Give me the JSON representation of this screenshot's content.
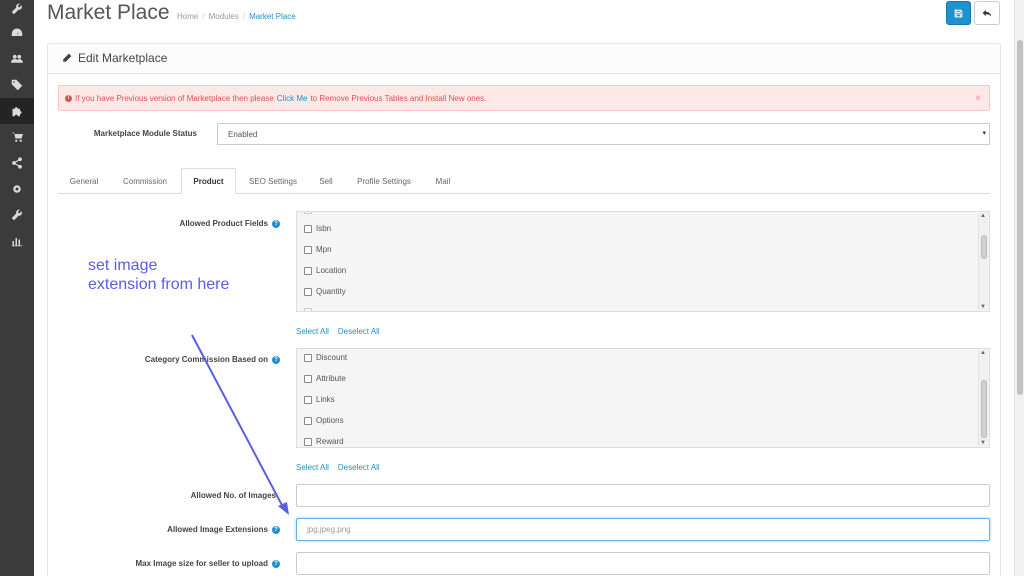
{
  "header": {
    "title": "Market Place",
    "breadcrumb": [
      "Home",
      "Modules",
      "Market Place"
    ],
    "breadcrumb_sep": "/",
    "save_icon": "save-icon",
    "back_icon": "reply-icon"
  },
  "sidebar": {
    "items": [
      {
        "icon": "wrench-icon"
      },
      {
        "icon": "dashboard-icon"
      },
      {
        "icon": "users-icon"
      },
      {
        "icon": "tags-icon"
      },
      {
        "icon": "puzzle-icon",
        "active": true
      },
      {
        "icon": "cart-icon"
      },
      {
        "icon": "share-icon"
      },
      {
        "icon": "gear-icon"
      },
      {
        "icon": "wrench-icon"
      },
      {
        "icon": "bar-chart-icon"
      }
    ]
  },
  "panel": {
    "title": "Edit Marketplace",
    "title_icon": "pencil-icon"
  },
  "alert": {
    "text_before": "If you have Previous version of Marketplace then please",
    "link": "Click Me",
    "text_after": "to Remove Previous Tables and Install New ones.",
    "close": "×"
  },
  "status": {
    "label": "Marketplace Module Status",
    "value": "Enabled"
  },
  "tabs": [
    "General",
    "Commission",
    "Product",
    "SEO Settings",
    "Sell",
    "Profile Settings",
    "Mail"
  ],
  "active_tab": "Product",
  "allowed_product_fields": {
    "label": "Allowed Product Fields",
    "items": [
      "Isbn",
      "Mpn",
      "Location",
      "Quantity"
    ]
  },
  "category_commission": {
    "label": "Category Commission Based on",
    "items": [
      "Discount",
      "Attribute",
      "Links",
      "Options",
      "Reward"
    ]
  },
  "select_all": "Select All",
  "deselect_all": "Deselect All",
  "allowed_images": {
    "label": "Allowed No. of Images",
    "value": ""
  },
  "allowed_extensions": {
    "label": "Allowed Image Extensions",
    "placeholder": "jpg,jpeg,png"
  },
  "max_image_size": {
    "label": "Max Image size for seller to upload",
    "value": ""
  },
  "annotation": {
    "text": "set image\nextension from here",
    "color": "#5a5ee0"
  },
  "colors": {
    "primary": "#1e91cf",
    "sidebar": "#3b3b3b",
    "alert_bg": "#fce8e7",
    "alert_text": "#d9534f"
  }
}
